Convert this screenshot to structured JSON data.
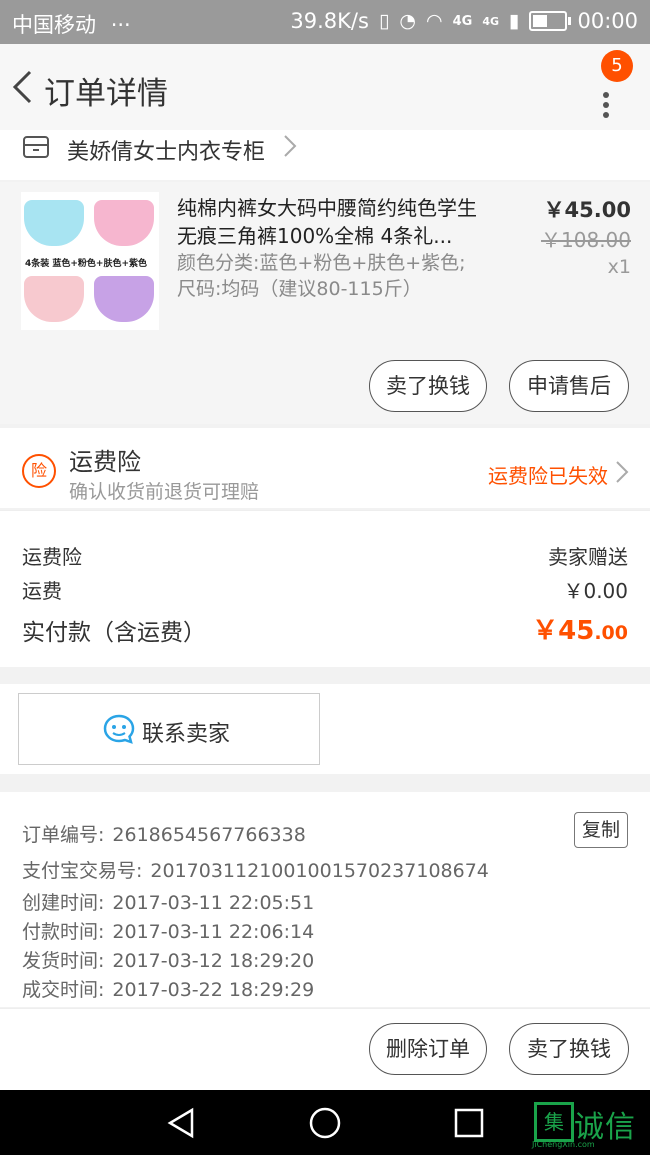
{
  "status_bar": {
    "carrier": "中国移动",
    "dots": "···",
    "speed": "39.8K/s",
    "network": "4G",
    "network2": "4G",
    "time": "00:00"
  },
  "header": {
    "title": "订单详情",
    "badge_count": "5"
  },
  "store": {
    "name": "美娇倩女士内衣专柜"
  },
  "product": {
    "name": "纯棉内裤女大码中腰简约纯色学生无痕三角裤100%全棉 4条礼...",
    "sku_line1": "颜色分类:蓝色+粉色+肤色+紫色;",
    "sku_line2": "尺码:均码（建议80-115斤）",
    "price": "￥45.00",
    "original_price": "￥108.00",
    "quantity": "x1",
    "thumb_text": "4条装 蓝色+粉色+肤色+紫色",
    "buttons": [
      "卖了换钱",
      "申请售后"
    ]
  },
  "insurance": {
    "title": "运费险",
    "subtitle": "确认收货前退货可理赔",
    "status": "运费险已失效",
    "icon_char": "险",
    "status_color": "#ff5000"
  },
  "fees": {
    "rows": [
      {
        "label": "运费险",
        "value": "卖家赠送"
      },
      {
        "label": "运费",
        "value": "￥0.00"
      }
    ],
    "total_label": "实付款（含运费）",
    "total_main": "￥45",
    "total_decimal": ".00"
  },
  "contact": {
    "label": "联系卖家"
  },
  "order_info": {
    "copy_label": "复制",
    "rows": [
      {
        "label": "订单编号:",
        "value": "2618654567766338"
      },
      {
        "label": "支付宝交易号:",
        "value": "2017031121001001570237108674"
      },
      {
        "label": "创建时间:",
        "value": "2017-03-11 22:05:51"
      },
      {
        "label": "付款时间:",
        "value": "2017-03-11 22:06:14"
      },
      {
        "label": "发货时间:",
        "value": "2017-03-12 18:29:20"
      },
      {
        "label": "成交时间:",
        "value": "2017-03-22 18:29:29"
      }
    ]
  },
  "actions": {
    "delete_label": "删除订单",
    "sell_label": "卖了换钱"
  },
  "watermark": {
    "box_char": "集",
    "text": "诚信",
    "sub": "JiChengXin.com"
  },
  "colors": {
    "accent": "#ff5000",
    "watermark": "#1aa34a"
  },
  "icons": [
    "back-icon",
    "more-icon",
    "store-icon",
    "chevron-right-icon",
    "insurance-icon",
    "chat-icon",
    "nav-back-icon",
    "nav-home-icon",
    "nav-recents-icon"
  ]
}
